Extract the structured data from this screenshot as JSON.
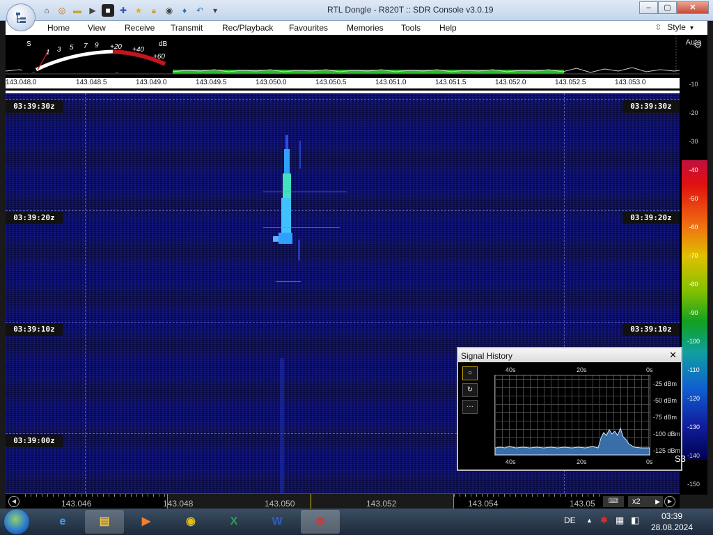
{
  "window": {
    "title": "RTL Dongle - R820T :: SDR Console v3.0.19",
    "minimize": "‒",
    "maximize": "▢",
    "close": "✕"
  },
  "qat_icons": [
    "home-icon",
    "lifebuoy-icon",
    "folder-icon",
    "play-icon",
    "stop-icon",
    "add-icon",
    "star-icon",
    "lock-icon",
    "camera-icon",
    "pin-icon",
    "undo-icon",
    "dropdown-icon"
  ],
  "menu": {
    "items": [
      "Home",
      "View",
      "Receive",
      "Transmit",
      "Rec/Playback",
      "Favourites",
      "Memories",
      "Tools",
      "Help"
    ],
    "style_label": "Style"
  },
  "smeter": {
    "s_label": "S",
    "db_label": "dB",
    "s_ticks": [
      "1",
      "3",
      "5",
      "7",
      "9"
    ],
    "plus_ticks": [
      "+20",
      "+40",
      "+60"
    ],
    "needle_fraction": 0.05
  },
  "spectrum_scale": [
    "143.048.0",
    "143.048.5",
    "143.049.0",
    "143.049.5",
    "143.050.0",
    "143.050.5",
    "143.051.0",
    "143.051.5",
    "143.052.0",
    "143.052.5",
    "143.053.0"
  ],
  "db_scale": {
    "auto_label": "Auto",
    "ticks": [
      "-10",
      "-20",
      "-30",
      "-40",
      "-50",
      "-60",
      "-70",
      "-80",
      "-90",
      "-100",
      "-110",
      "-120",
      "-130",
      "-140",
      "-150"
    ]
  },
  "waterfall": {
    "time_labels": [
      "03:39:30z",
      "03:39:20z",
      "03:39:10z",
      "03:39:00z"
    ]
  },
  "tuning_bar": {
    "freqs": [
      "143.046",
      "143.048",
      "143.050",
      "143.052",
      "143.054",
      "143.05"
    ],
    "zoom": "x2"
  },
  "signal_history": {
    "title": "Signal History",
    "close": "✕",
    "x_top": [
      "40s",
      "20s",
      "0s"
    ],
    "x_bottom": [
      "40s",
      "20s",
      "0s"
    ],
    "y_labels": [
      "-25 dBm",
      "-50 dBm",
      "-75 dBm",
      "-100 dBm",
      "-125 dBm"
    ],
    "s_reading": "S3",
    "btn_more": "···"
  },
  "taskbar": {
    "lang": "DE",
    "time": "03:39",
    "date": "28.08.2024",
    "apps": [
      "internet-explorer",
      "file-explorer",
      "media-player",
      "chrome",
      "excel",
      "word",
      "sdr-console"
    ]
  },
  "colors": {
    "waterfall_bg": "#0d1060",
    "signal": "#40e0ff",
    "spectrum_trace": "#2fb82f",
    "smeter_red": "#c0161c"
  }
}
